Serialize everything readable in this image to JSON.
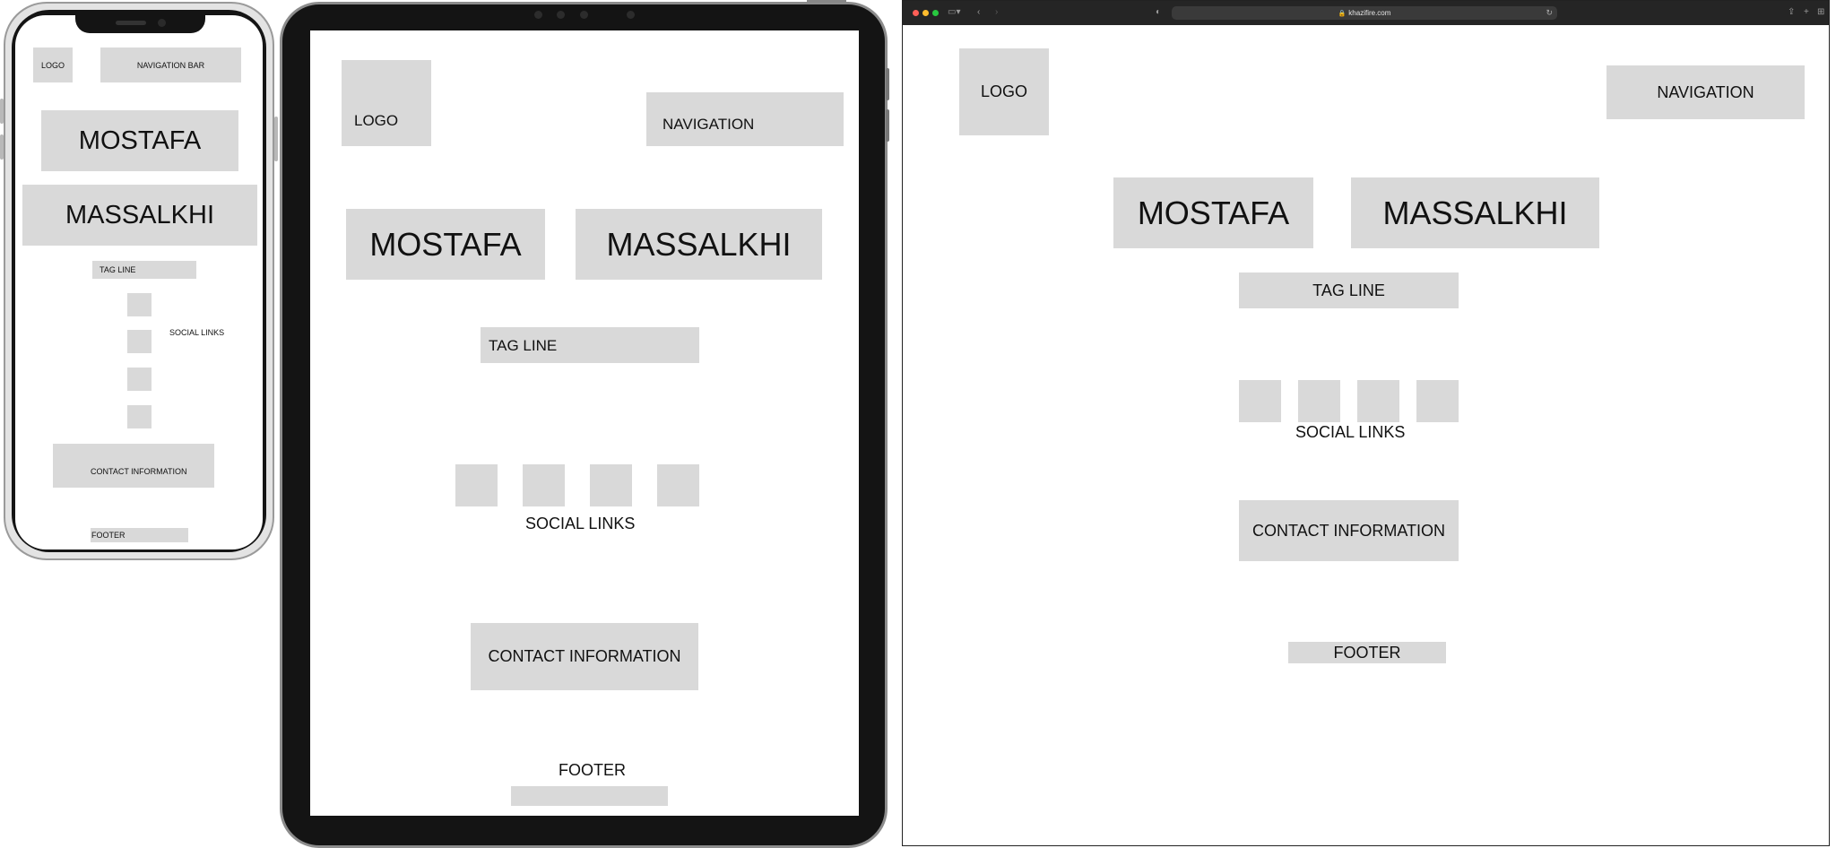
{
  "phone": {
    "logo": "LOGO",
    "nav": "NAVIGATION BAR",
    "name_first": "MOSTAFA",
    "name_last": "MASSALKHI",
    "tagline": "TAG LINE",
    "social": "SOCIAL LINKS",
    "contact": "CONTACT INFORMATION",
    "footer": "FOOTER"
  },
  "tablet": {
    "logo": "LOGO",
    "nav": "NAVIGATION",
    "name_first": "MOSTAFA",
    "name_last": "MASSALKHI",
    "tagline": "TAG LINE",
    "social": "SOCIAL LINKS",
    "contact": "CONTACT INFORMATION",
    "footer": "FOOTER"
  },
  "desktop": {
    "url": "khazifire.com",
    "logo": "LOGO",
    "nav": "NAVIGATION",
    "name_first": "MOSTAFA",
    "name_last": "MASSALKHI",
    "tagline": "TAG LINE",
    "social": "SOCIAL LINKS",
    "contact": "CONTACT INFORMATION",
    "footer": "FOOTER"
  },
  "colors": {
    "placeholder": "#d9d9d9",
    "device_bezel": "#141414",
    "browser_chrome": "#252525",
    "traffic_red": "#ff5f57",
    "traffic_yellow": "#febc2e",
    "traffic_green": "#28c840"
  },
  "icons": {
    "chrome": [
      "sidebar-icon",
      "back-icon",
      "forward-icon",
      "shield-icon",
      "lock-icon",
      "reload-icon",
      "share-icon",
      "new-tab-icon",
      "tabs-overview-icon"
    ]
  }
}
